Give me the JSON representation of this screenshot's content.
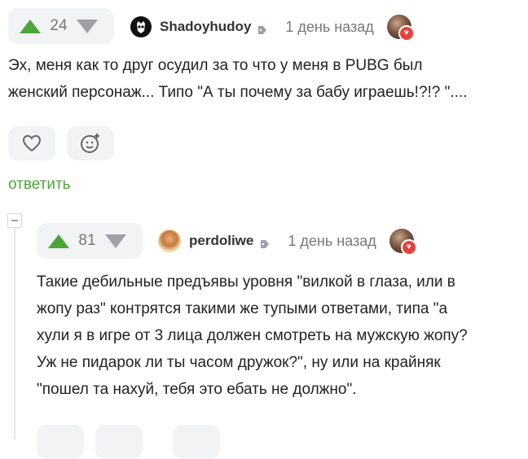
{
  "colors": {
    "accent_green": "#4da53a",
    "vote_bg": "#f2f3f5",
    "muted_text": "#777777",
    "badge_red": "#e8413c"
  },
  "comment1": {
    "rating": "24",
    "username": "Shadoyhudoy",
    "time": "1 день назад",
    "text_lines": [
      "Эх, меня как то друг осудил за то что у меня в PUBG был",
      "женский персонаж... Типо \"А ты почему за бабу играешь!?!? \"...."
    ],
    "icons": [
      "arrow-up-icon",
      "arrow-down-icon",
      "tag-icon",
      "heart-icon",
      "add-emoji-icon"
    ],
    "reply_label": "ответить"
  },
  "comment2": {
    "rating": "81",
    "username": "perdoliwe",
    "time": "1 день назад",
    "text_lines": [
      "Такие дебильные предъявы уровня \"вилкой в глаза, или в",
      "жопу раз\" контрятся такими же тупыми ответами, типа \"а",
      "хули я в игре от 3 лица должен смотреть на мужскую жопу?",
      "Уж не пидарок ли ты часом дружок?\", ну или на крайняк",
      "\"пошел та нахуй, тебя это ебать не должно\"."
    ]
  }
}
